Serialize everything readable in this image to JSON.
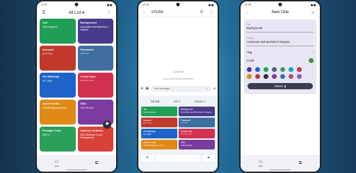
{
  "phone1": {
    "status_time": "12:29",
    "title": "All List",
    "title_caret": "▾",
    "cards": [
      {
        "title": "Job",
        "value": "Soft Engineer",
        "color": "#1f9e55"
      },
      {
        "title": "Background",
        "value": "Associate and Bachelor's Degree",
        "color": "#4a3a8c"
      },
      {
        "title": "Account",
        "value": "a*******a",
        "color": "#c0392b"
      },
      {
        "title": "Password",
        "value": "*********",
        "color": "#3d6e9e"
      },
      {
        "title": "Girl Birthday",
        "value": "3/1 1981",
        "color": "#1e63c8"
      },
      {
        "title": "Credit Card",
        "value": "****-****-****",
        "color": "#d1314e"
      },
      {
        "title": "John's email",
        "value": "John007@icloud.com",
        "color": "#e08a16"
      },
      {
        "title": "SSN",
        "value": "219-03-4111",
        "color": "#7b3aa0"
      },
      {
        "title": "Postage Code",
        "value": "30074",
        "color": "#2aa05a"
      },
      {
        "title": "Address Delivery",
        "value": "305 Winthrop Court, Montgomery",
        "color": "#d8423b"
      }
    ],
    "fab_icon": "✚",
    "nav": [
      {
        "icon": "▭",
        "label": "Edit"
      },
      {
        "icon": "⧉",
        "label": ""
      }
    ]
  },
  "phone2": {
    "status_time": "12:28",
    "number": "075358",
    "message_time": "12:28 PM",
    "texting_note": "Texting with 075358 (SMS/MMS)",
    "placeholder": "Text message",
    "tabs": [
      "All List",
      "Job ▾",
      "Delete ▾"
    ],
    "cards": [
      {
        "title": "Job",
        "value": "Soft Engineer",
        "color": "#1f9e55"
      },
      {
        "title": "Background",
        "value": "Associate and Bachelor's Degree",
        "color": "#4a3a8c"
      },
      {
        "title": "Account",
        "value": "a*******a",
        "color": "#c0392b"
      },
      {
        "title": "Password",
        "value": "*********",
        "color": "#3d6e9e"
      },
      {
        "title": "Girl Birthday",
        "value": "3/1 1981",
        "color": "#1e63c8"
      },
      {
        "title": "Credit Card",
        "value": "****-****-****",
        "color": "#d1314e"
      },
      {
        "title": "John's email",
        "value": "John007@icloud.com",
        "color": "#e08a16"
      },
      {
        "title": "SSN",
        "value": "219-03-4111",
        "color": "#7b3aa0"
      }
    ],
    "close_icon": "✕",
    "send_icon": "➤"
  },
  "phone3": {
    "status_time": "12:28",
    "title": "New One",
    "title_field": {
      "label": "Title",
      "value": "Background"
    },
    "content_field": {
      "label": "Content",
      "value": "Associate and Bachelor's Degree"
    },
    "tag_label": "Tag",
    "color_label": "Color",
    "selected_color": "#4a8c3a",
    "swatches": [
      "#4a3a8c",
      "#1e63c8",
      "#2aa05a",
      "#5a5a8c",
      "#4a9a5a",
      "#1aa0c8",
      "#d1314e",
      "#e08a16",
      "#c0392b",
      "#2b2f36",
      "#7b3aa0",
      "#3d6e9e",
      "#b05070",
      "#8a60c0"
    ],
    "delete_label": "Delete",
    "nav": [
      {
        "icon": "▭",
        "label": "Edit"
      },
      {
        "icon": "⧉",
        "label": ""
      }
    ]
  }
}
